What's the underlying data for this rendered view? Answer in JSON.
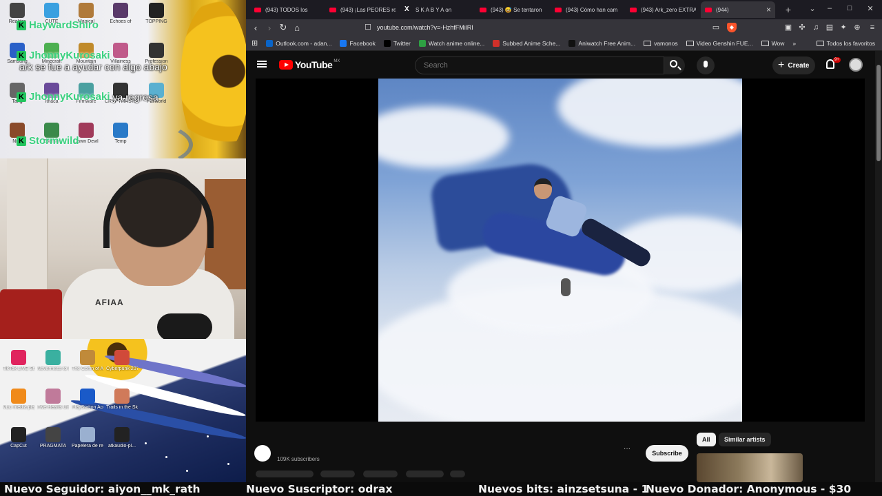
{
  "overlay": {
    "chat": [
      {
        "user": "HaywardShiro",
        "message": ""
      },
      {
        "user": "JhonnyKurosaki",
        "message": "ark se fue a ayudar con algo abajo"
      },
      {
        "user": "JhonnyKurosaki",
        "message": "ya regresa"
      },
      {
        "user": "Stormwild",
        "message": ""
      }
    ],
    "kick_badge": "K",
    "desktop_icons_top": [
      {
        "label": "Reaktor",
        "color": "#444"
      },
      {
        "label": "Samsung",
        "color": "#2a60c8"
      },
      {
        "label": "Tang",
        "color": "#666"
      },
      {
        "label": "Nikk",
        "color": "#8a4a2a"
      },
      {
        "label": "CUTE",
        "color": "#3aa0e0"
      },
      {
        "label": "Minecraft",
        "color": "#4caf50"
      },
      {
        "label": "Ithaca",
        "color": "#6a4a9a"
      },
      {
        "label": "Zoomer",
        "color": "#3a8a4a"
      },
      {
        "label": "Magical",
        "color": "#b07a3a"
      },
      {
        "label": "Mountain",
        "color": "#c08a2a"
      },
      {
        "label": "Firmware",
        "color": "#4aa0a0"
      },
      {
        "label": "Dawn Devil",
        "color": "#a03a5a"
      },
      {
        "label": "Echoes of",
        "color": "#5a3a6a"
      },
      {
        "label": "Villainess",
        "color": "#c05a8a"
      },
      {
        "label": "CRYPTMASTE",
        "color": "#333"
      },
      {
        "label": "Temp",
        "color": "#2a7ac8"
      },
      {
        "label": "TOPPING",
        "color": "#222"
      },
      {
        "label": "Profession",
        "color": "#333"
      },
      {
        "label": "Pallworld",
        "color": "#5ab0d0"
      }
    ],
    "shirt_logo": "AFIAA",
    "desktop_icons_bottom": [
      {
        "label": "TikTok LIVE Studio",
        "color": "#e0245e"
      },
      {
        "label": "Nevermess to Evenness",
        "color": "#3ab0a0"
      },
      {
        "label": "The Coffin of Andy and Le...",
        "color": "#c08a3a"
      },
      {
        "label": "Cyberpunk 2077",
        "color": "#d04a3a"
      },
      {
        "label": "VLC media player",
        "color": "#f08a1a"
      },
      {
        "label": "Five Hearts Under O...",
        "color": "#c07a9a"
      },
      {
        "label": "PlayStation Accessories",
        "color": "#1a5ac8"
      },
      {
        "label": "Trails in the Sky 1st C...",
        "color": "#d07a5a"
      },
      {
        "label": "CapCut",
        "color": "#222"
      },
      {
        "label": "PRAGMATA",
        "color": "#444"
      },
      {
        "label": "Papelera de reciclaje",
        "color": "#9ab0d0"
      },
      {
        "label": "atkaudio-pl...",
        "color": "#222"
      }
    ]
  },
  "browser": {
    "tabs": [
      {
        "title": "(943) TODOS los",
        "icon": "youtube"
      },
      {
        "title": "(943) ¡Las PEORES re",
        "icon": "youtube"
      },
      {
        "title": "S K A B Y A on",
        "icon": "x"
      },
      {
        "title": "(943) 😅 Se tentaron",
        "icon": "youtube"
      },
      {
        "title": "(943) Cómo han cam",
        "icon": "youtube"
      },
      {
        "title": "(943) Ark_zero EXTRA",
        "icon": "youtube"
      },
      {
        "title": "(944)",
        "icon": "youtube",
        "active": true
      }
    ],
    "new_tab": "+",
    "window_controls": {
      "dropdown": "⌄",
      "minimize": "–",
      "maximize": "□",
      "close": "✕"
    },
    "url": "youtube.com/watch?v=-HzhfFMilRI",
    "bookmarks": [
      {
        "label": "Outlook.com - adan...",
        "color": "#0a64c8"
      },
      {
        "label": "Facebook",
        "color": "#1877f2"
      },
      {
        "label": "Twitter",
        "color": "#000"
      },
      {
        "label": "Watch anime online...",
        "color": "#2ea043"
      },
      {
        "label": "Subbed Anime Sche...",
        "color": "#d0302a"
      },
      {
        "label": "Aniwatch Free Anim...",
        "color": "#111"
      },
      {
        "label": "vamonos",
        "folder": true
      },
      {
        "label": "Video Genshin FUE...",
        "folder": true
      },
      {
        "label": "Wow",
        "folder": true
      }
    ],
    "bookmarks_more": "»",
    "all_bookmarks": "Todos los favoritos"
  },
  "youtube": {
    "logo_text": "YouTube",
    "region": "MX",
    "search_placeholder": "Search",
    "create_label": "Create",
    "create_plus": "+",
    "notifications_badge": "9+",
    "subscribers": "109K subscribers",
    "subscribe_label": "Subscribe",
    "more": "···",
    "chips": [
      "All",
      "Similar artists"
    ]
  },
  "ticker": [
    {
      "text": "Nuevo Seguidor: aiyon__mk_rath"
    },
    {
      "text": "Nuevo Suscriptor: odrax"
    },
    {
      "text": "Nuevos bits: ainzsetsuna - 1"
    },
    {
      "text": "Nuevo Donador: Anonymous - $30"
    }
  ]
}
